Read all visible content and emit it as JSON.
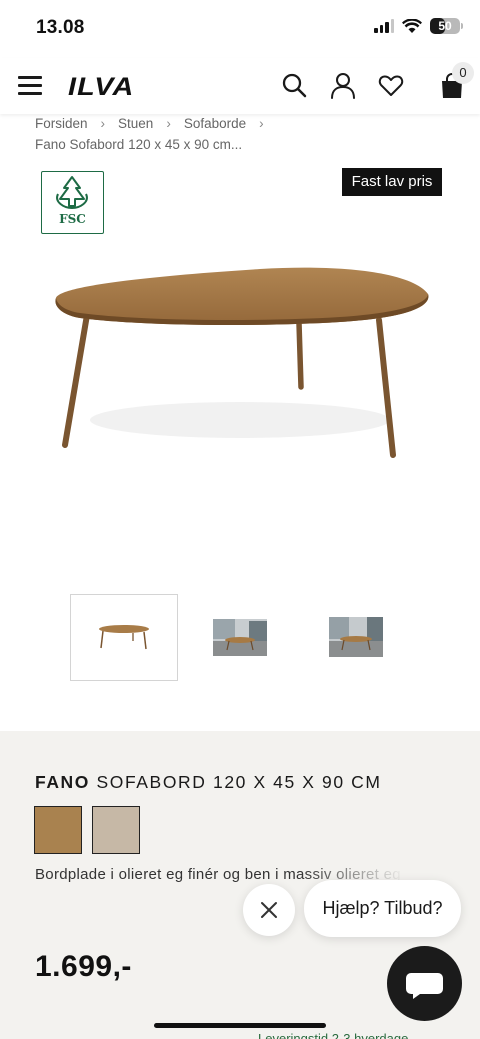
{
  "status_bar": {
    "time": "13.08",
    "battery_percent": "50",
    "battery_level": 0.5
  },
  "header": {
    "logo": "ILVA",
    "cart_count": "0"
  },
  "breadcrumb": {
    "items": [
      "Forsiden",
      "Stuen",
      "Sofaborde"
    ],
    "separator": "›",
    "current": "Fano Sofabord 120 x 45 x 90 cm..."
  },
  "product": {
    "certification": "FSC",
    "badge": "Fast lav pris",
    "title_bold": "FANO",
    "title_rest": " SOFABORD 120 X 45 X 90 CM",
    "colors": [
      "#a9824f",
      "#c6b8a6"
    ],
    "description": "Bordplade i olieret eg finér og ben i massiv olieret eg",
    "price": "1.699,-",
    "thumbnail_count": 3
  },
  "chat": {
    "prompt": "Hjælp? Tilbud?"
  },
  "footer": {
    "partial_text": "Leveringstid 2-3 hverdage"
  },
  "colors": {
    "info_bg": "#f3f2ef",
    "badge_bg": "#111111",
    "fsc_green": "#1e6b45",
    "wood": "#9a7340"
  }
}
